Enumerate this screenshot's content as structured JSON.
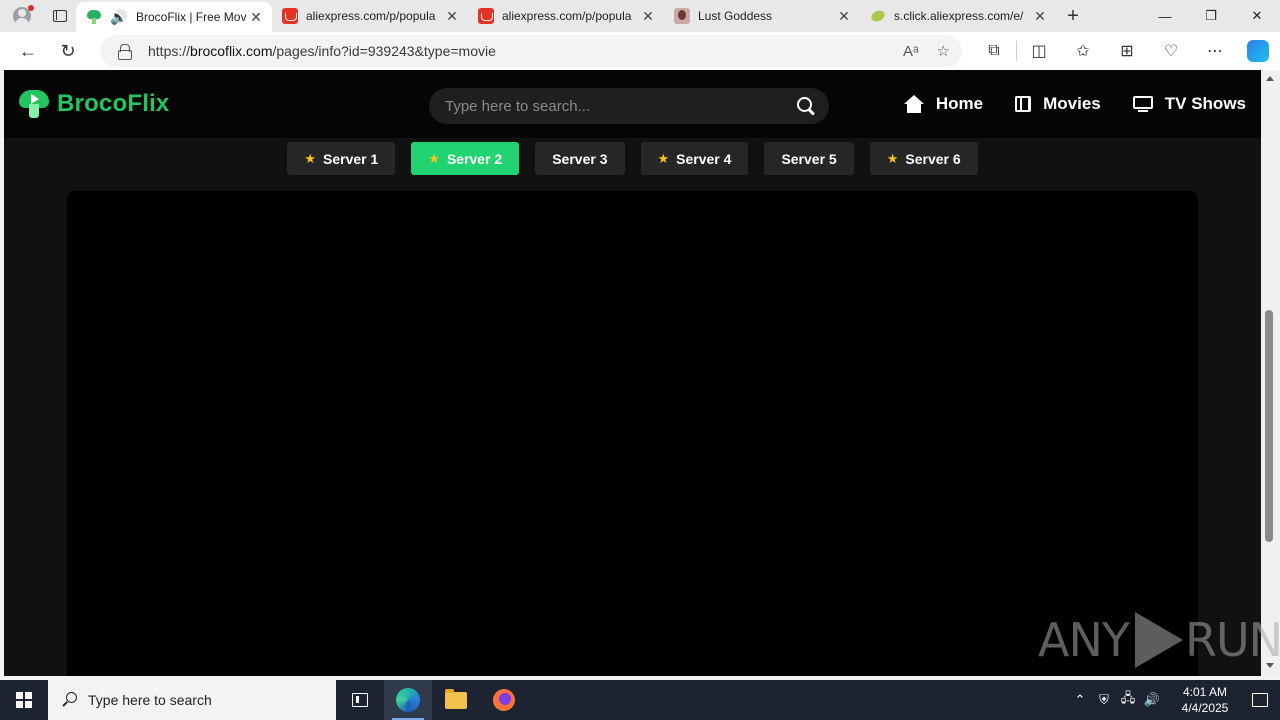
{
  "browser": {
    "tabs": [
      {
        "title": "BrocoFlix | Free Mov",
        "favicon": "brocoflix-icon",
        "active": true,
        "audio": true
      },
      {
        "title": "aliexpress.com/p/popula",
        "favicon": "aliexpress-icon"
      },
      {
        "title": "aliexpress.com/p/popula",
        "favicon": "aliexpress-icon"
      },
      {
        "title": "Lust Goddess",
        "favicon": "lust-goddess-icon"
      },
      {
        "title": "s.click.aliexpress.com/e/",
        "favicon": "click-icon"
      }
    ],
    "address": {
      "prefix": "https://",
      "domain": "brocoflix.com",
      "path": "/pages/info?id=939243&type=movie"
    }
  },
  "site": {
    "brand": "BrocoFlix",
    "search_placeholder": "Type here to search...",
    "nav": [
      {
        "label": "Home",
        "icon": "home-icon"
      },
      {
        "label": "Movies",
        "icon": "film-icon"
      },
      {
        "label": "TV Shows",
        "icon": "tv-icon"
      }
    ],
    "servers": [
      {
        "label": "Server 1",
        "starred": true,
        "active": false
      },
      {
        "label": "Server 2",
        "starred": true,
        "active": true
      },
      {
        "label": "Server 3",
        "starred": false,
        "active": false
      },
      {
        "label": "Server 4",
        "starred": true,
        "active": false
      },
      {
        "label": "Server 5",
        "starred": false,
        "active": false
      },
      {
        "label": "Server 6",
        "starred": true,
        "active": false
      }
    ],
    "accent_color": "#22c55e"
  },
  "watermark": {
    "left": "ANY",
    "right": "RUN"
  },
  "taskbar": {
    "search_placeholder": "Type here to search",
    "time": "4:01 AM",
    "date": "4/4/2025"
  }
}
